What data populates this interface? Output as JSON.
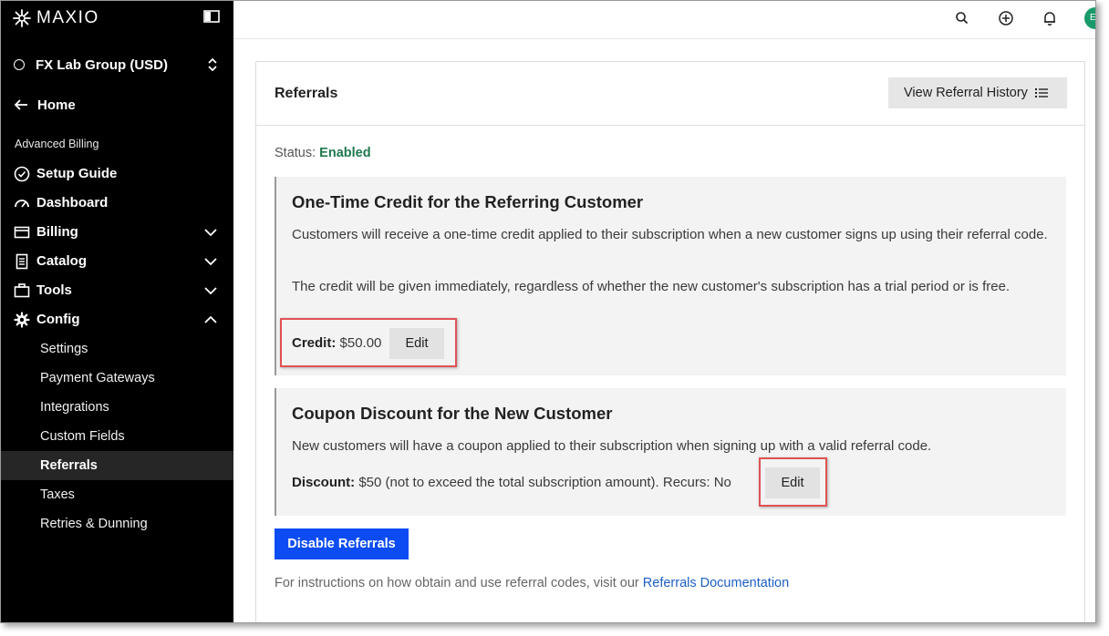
{
  "brand": {
    "name": "MAXIO"
  },
  "site_selector": {
    "label": "FX Lab Group (USD)"
  },
  "nav": {
    "home_label": "Home",
    "section_label": "Advanced Billing",
    "items": [
      {
        "label": "Setup Guide",
        "icon": "check-circle-icon"
      },
      {
        "label": "Dashboard",
        "icon": "gauge-icon"
      },
      {
        "label": "Billing",
        "icon": "card-icon",
        "expanded": false
      },
      {
        "label": "Catalog",
        "icon": "document-icon",
        "expanded": false
      },
      {
        "label": "Tools",
        "icon": "briefcase-icon",
        "expanded": false
      },
      {
        "label": "Config",
        "icon": "gear-icon",
        "expanded": true
      }
    ],
    "config_subitems": [
      {
        "label": "Settings"
      },
      {
        "label": "Payment Gateways"
      },
      {
        "label": "Integrations"
      },
      {
        "label": "Custom Fields"
      },
      {
        "label": "Referrals",
        "active": true
      },
      {
        "label": "Taxes"
      },
      {
        "label": "Retries & Dunning"
      }
    ]
  },
  "topbar": {
    "avatar_initial": "E"
  },
  "page": {
    "title": "Referrals",
    "history_button": "View Referral History",
    "status_label": "Status:",
    "status_value": "Enabled",
    "credit_panel": {
      "title": "One-Time Credit for the Referring Customer",
      "text1": "Customers will receive a one-time credit applied to their subscription when a new customer signs up using their referral code.",
      "text2": "The credit will be given immediately, regardless of whether the new customer's subscription has a trial period or is free.",
      "field_key": "Credit:",
      "field_value": "$50.00",
      "edit_label": "Edit"
    },
    "coupon_panel": {
      "title": "Coupon Discount for the New Customer",
      "text1": "New customers will have a coupon applied to their subscription when signing up with a valid referral code.",
      "field_key": "Discount:",
      "field_value": "$50 (not to exceed the total subscription amount). Recurs: No",
      "edit_label": "Edit"
    },
    "disable_button": "Disable Referrals",
    "footnote_text": "For instructions on how obtain and use referral codes, visit our",
    "footnote_link": "Referrals Documentation"
  },
  "colors": {
    "sidebar_bg": "#000000",
    "primary_button": "#0d4cf2",
    "status_enabled": "#1e7a4f",
    "link": "#1d5fc4",
    "highlight": "#e05252"
  }
}
